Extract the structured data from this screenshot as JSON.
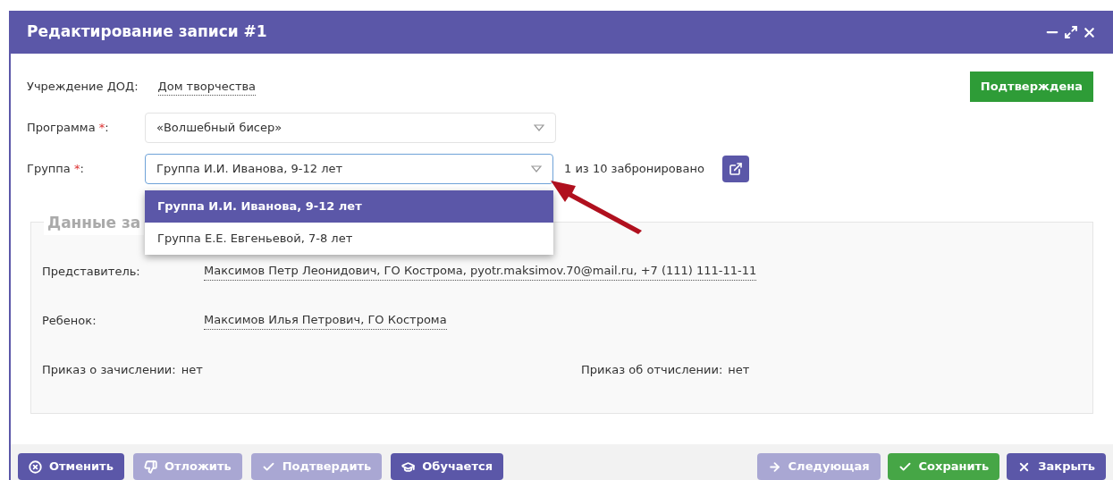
{
  "window": {
    "title": "Редактирование записи #1"
  },
  "institution": {
    "label": "Учреждение ДОД:",
    "value": "Дом творчества"
  },
  "status_badge": "Подтверждена",
  "program": {
    "label": "Программа",
    "required_mark": "*",
    "colon": ":",
    "value": "«Волшебный бисер»"
  },
  "group": {
    "label": "Группа",
    "required_mark": "*",
    "colon": ":",
    "value": "Группа И.И. Иванова, 9-12 лет",
    "expanded": true,
    "booking": "1 из 10 забронировано",
    "options": [
      {
        "label": "Группа И.И. Иванова, 9-12 лет",
        "selected": true
      },
      {
        "label": "Группа Е.Е. Евгеньевой, 7-8 лет",
        "selected": false
      }
    ]
  },
  "section": {
    "legend": "Данные за",
    "rows": [
      {
        "label": "Представитель:",
        "value": "Максимов Петр Леонидович, ГО Кострома, pyotr.maksimov.70@mail.ru, +7 (111) 111-11-11"
      },
      {
        "label": "Ребенок:",
        "value": "Максимов Илья Петрович, ГО Кострома"
      }
    ],
    "orders": [
      {
        "label": "Приказ о зачислении:",
        "value": "нет"
      },
      {
        "label": "Приказ об отчислении:",
        "value": "нет"
      }
    ]
  },
  "buttons": [
    {
      "label": "Отменить",
      "kind": "cancel",
      "disabled": false
    },
    {
      "label": "Отложить",
      "kind": "postpone",
      "disabled": true
    },
    {
      "label": "Подтвердить",
      "kind": "confirm",
      "disabled": true
    },
    {
      "label": "Обучается",
      "kind": "study",
      "disabled": false
    },
    {
      "label": "Следующая",
      "kind": "next",
      "disabled": true
    },
    {
      "label": "Сохранить",
      "kind": "save",
      "disabled": false
    },
    {
      "label": "Закрыть",
      "kind": "close",
      "disabled": false
    }
  ]
}
